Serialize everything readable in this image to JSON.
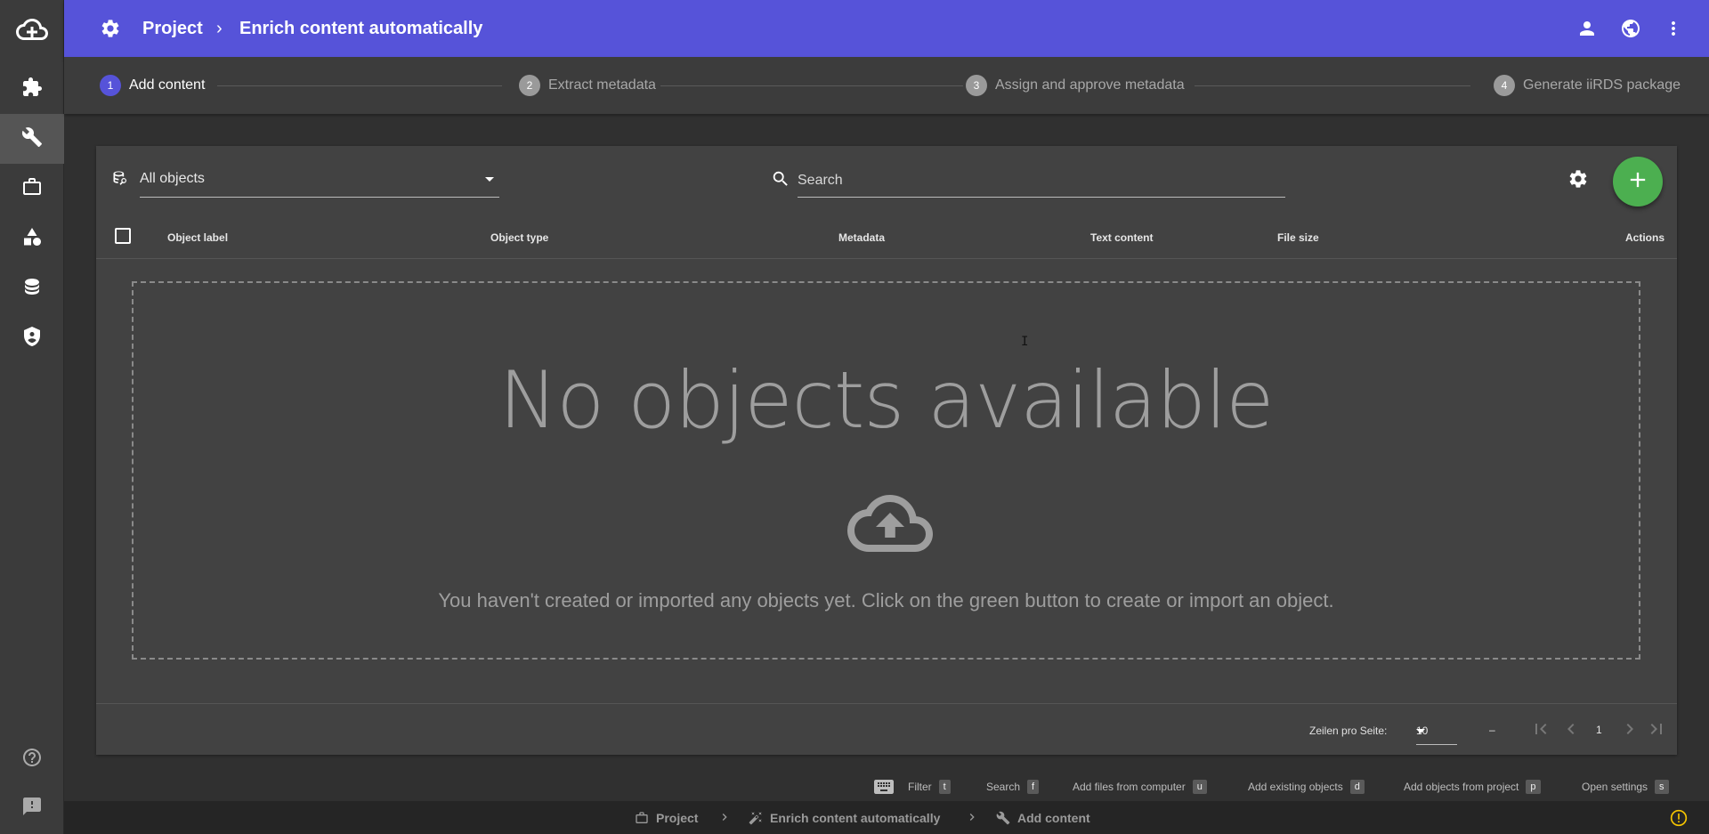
{
  "rail": {
    "items": [
      {
        "icon": "cloud-add-icon"
      },
      {
        "icon": "puzzle-icon"
      },
      {
        "icon": "wrench-icon"
      },
      {
        "icon": "briefcase-icon"
      },
      {
        "icon": "shapes-icon"
      },
      {
        "icon": "database-icon"
      },
      {
        "icon": "shield-account-icon"
      }
    ],
    "active_index": 2,
    "bottom_items": [
      {
        "icon": "help-icon"
      },
      {
        "icon": "feedback-icon"
      }
    ]
  },
  "header": {
    "project": "Project",
    "separator": "›",
    "title": "Enrich content automatically",
    "background": "#5653d9"
  },
  "stepper": {
    "steps": [
      {
        "num": "1",
        "label": "Add content",
        "active": true
      },
      {
        "num": "2",
        "label": "Extract metadata",
        "active": false
      },
      {
        "num": "3",
        "label": "Assign and approve metadata",
        "active": false
      },
      {
        "num": "4",
        "label": "Generate iiRDS package",
        "active": false
      }
    ]
  },
  "toolbar": {
    "filter_value": "All objects",
    "search_placeholder": "Search",
    "add_color": "#4caf50"
  },
  "table": {
    "columns": [
      "Object label",
      "Object type",
      "Metadata",
      "Text content",
      "File size",
      "Actions"
    ]
  },
  "empty": {
    "title": "No objects available",
    "message": "You haven't created or imported any objects yet. Click on the green button to create or import an object."
  },
  "paginator": {
    "rows_label": "Zeilen pro Seite:",
    "page_size": "10",
    "range": "–",
    "page": "1"
  },
  "shortcuts": [
    {
      "label": "Filter",
      "key": "t"
    },
    {
      "label": "Search",
      "key": "f"
    },
    {
      "label": "Add files from computer",
      "key": "u"
    },
    {
      "label": "Add existing objects",
      "key": "d"
    },
    {
      "label": "Add objects from project",
      "key": "p"
    },
    {
      "label": "Open settings",
      "key": "s"
    }
  ],
  "statusbar": {
    "items": [
      "Project",
      "Enrich content automatically",
      "Add content"
    ],
    "warning_color": "#f5c400"
  }
}
